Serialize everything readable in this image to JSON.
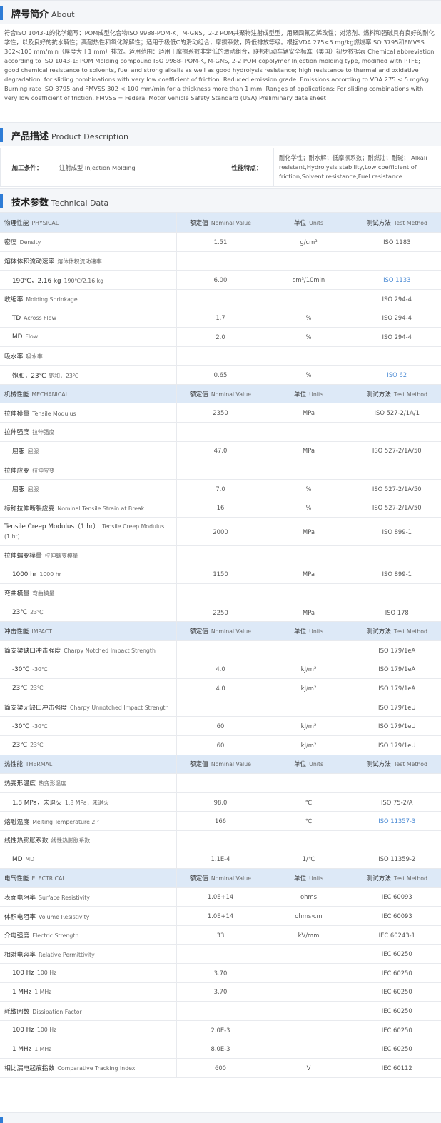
{
  "sections": {
    "about": {
      "cn": "牌号简介",
      "en": "About"
    },
    "desc": {
      "cn": "产品描述",
      "en": "Product Description"
    },
    "tech": {
      "cn": "技术参数",
      "en": "Technical Data"
    }
  },
  "about_text": "符合ISO 1043-1的化学缩写：POM成型化合物ISO 9988-POM-K，M-GNS，2-2 POM共聚物注射成型型，用聚四氟乙烯改性；对溶剂、燃料和强碱具有良好的耐化学性，以及良好的抗水解性；高耐热性和氧化降解性；适用于极低C的滑动组合，摩擦系数，降低排放等级。根据VDA 275<5 mg/kg燃烧率ISO 3795和FMVSS 302<100 mm/min（厚度大于1 mm）排放。适用范围：适用于摩擦系数非常低的滑动组合，联邦机动车辆安全标准（美国）初步数据表 Chemical abbreviation according to ISO 1043-1: POM Molding compound ISO 9988- POM-K, M-GNS, 2-2 POM copolymer Injection molding type, modified with PTFE; good chemical resistance to solvents, fuel and strong alkalis as well as good hydrolysis resistance; high resistance to thermal and oxidative degradation; for sliding combinations with very low coefficient of friction. Reduced emission grade. Emissions according to VDA 275 < 5 mg/kg Burning rate ISO 3795 and FMVSS 302 < 100 mm/min for a thickness more than 1 mm. Ranges of applications: For sliding combinations with very low coefficient of friction. FMVSS = Federal Motor Vehicle Safety Standard (USA) Preliminary data sheet",
  "description": {
    "processing_label": "加工条件：",
    "processing_value": "注射成型  Injection Molding",
    "features_label": "性能特点：",
    "features_value": "耐化学性；耐水解；低摩擦系数；耐燃油；耐碱；  Alkali resistant,Hydrolysis stability,Low coefficient of friction,Solvent resistance,Fuel resistance"
  },
  "header_labels": {
    "nominal_cn": "额定值",
    "nominal_en": "Nominal Value",
    "units_cn": "单位",
    "units_en": "Units",
    "method_cn": "测试方法",
    "method_en": "Test Method"
  },
  "rows": [
    {
      "type": "cat",
      "cn": "物理性能",
      "en": "PHYSICAL"
    },
    {
      "type": "prop",
      "cn": "密度",
      "en": "Density",
      "value": "1.51",
      "unit": "g/cm³",
      "method": "ISO 1183"
    },
    {
      "type": "prop",
      "cn": "熔体体积流动速率",
      "en": "熔体体积流动速率",
      "value": "",
      "unit": "",
      "method": ""
    },
    {
      "type": "sub",
      "cn": "190℃，2.16 kg",
      "en": "190℃/2.16 kg",
      "value": "6.00",
      "unit": "cm³/10min",
      "method": "ISO 1133",
      "link": true
    },
    {
      "type": "prop",
      "cn": "收缩率",
      "en": "Molding Shrinkage",
      "value": "",
      "unit": "",
      "method": "ISO 294-4"
    },
    {
      "type": "sub",
      "cn": "TD",
      "en": "Across Flow",
      "value": "1.7",
      "unit": "%",
      "method": "ISO 294-4"
    },
    {
      "type": "sub",
      "cn": "MD",
      "en": "Flow",
      "value": "2.0",
      "unit": "%",
      "method": "ISO 294-4"
    },
    {
      "type": "prop",
      "cn": "吸水率",
      "en": "吸水率",
      "value": "",
      "unit": "",
      "method": ""
    },
    {
      "type": "sub",
      "cn": "饱和，23℃",
      "en": "饱和，23℃",
      "value": "0.65",
      "unit": "%",
      "method": "ISO 62",
      "link": true
    },
    {
      "type": "cat",
      "cn": "机械性能",
      "en": "MECHANICAL"
    },
    {
      "type": "prop",
      "cn": "拉伸模量",
      "en": "Tensile Modulus",
      "value": "2350",
      "unit": "MPa",
      "method": "ISO 527-2/1A/1"
    },
    {
      "type": "prop",
      "cn": "拉伸强度",
      "en": "拉伸强度",
      "value": "",
      "unit": "",
      "method": ""
    },
    {
      "type": "sub",
      "cn": "屈服",
      "en": "屈服",
      "value": "47.0",
      "unit": "MPa",
      "method": "ISO 527-2/1A/50"
    },
    {
      "type": "prop",
      "cn": "拉伸应变",
      "en": "拉伸应变",
      "value": "",
      "unit": "",
      "method": ""
    },
    {
      "type": "sub",
      "cn": "屈服",
      "en": "屈服",
      "value": "7.0",
      "unit": "%",
      "method": "ISO 527-2/1A/50"
    },
    {
      "type": "prop",
      "cn": "标称拉伸断裂应变",
      "en": "Nominal Tensile Strain at Break",
      "value": "16",
      "unit": "%",
      "method": "ISO 527-2/1A/50"
    },
    {
      "type": "prop",
      "tall": true,
      "cn": "Tensile Creep Modulus（1 hr）",
      "en": "Tensile Creep Modulus (1 hr)",
      "value": "2000",
      "unit": "MPa",
      "method": "ISO 899-1"
    },
    {
      "type": "prop",
      "cn": "拉伸蠕变模量",
      "en": "拉伸蠕变模量",
      "value": "",
      "unit": "",
      "method": ""
    },
    {
      "type": "sub",
      "cn": "1000 hr",
      "en": "1000 hr",
      "value": "1150",
      "unit": "MPa",
      "method": "ISO 899-1"
    },
    {
      "type": "prop",
      "cn": "弯曲模量",
      "en": "弯曲模量",
      "value": "",
      "unit": "",
      "method": ""
    },
    {
      "type": "sub",
      "cn": "23℃",
      "en": "23℃",
      "value": "2250",
      "unit": "MPa",
      "method": "ISO 178"
    },
    {
      "type": "cat",
      "cn": "冲击性能",
      "en": "IMPACT"
    },
    {
      "type": "prop",
      "cn": "简支梁缺口冲击强度",
      "en": "Charpy Notched Impact Strength",
      "value": "",
      "unit": "",
      "method": "ISO 179/1eA"
    },
    {
      "type": "sub",
      "cn": "-30℃",
      "en": "-30℃",
      "value": "4.0",
      "unit": "kJ/m²",
      "method": "ISO 179/1eA"
    },
    {
      "type": "sub",
      "cn": "23℃",
      "en": "23℃",
      "value": "4.0",
      "unit": "kJ/m²",
      "method": "ISO 179/1eA"
    },
    {
      "type": "prop",
      "cn": "简支梁无缺口冲击强度",
      "en": "Charpy Unnotched Impact Strength",
      "value": "",
      "unit": "",
      "method": "ISO 179/1eU"
    },
    {
      "type": "sub",
      "cn": "-30℃",
      "en": "-30℃",
      "value": "60",
      "unit": "kJ/m²",
      "method": "ISO 179/1eU"
    },
    {
      "type": "sub",
      "cn": "23℃",
      "en": "23℃",
      "value": "60",
      "unit": "kJ/m²",
      "method": "ISO 179/1eU"
    },
    {
      "type": "cat",
      "cn": "热性能",
      "en": "THERMAL"
    },
    {
      "type": "prop",
      "cn": "热变形温度",
      "en": "热变形温度",
      "value": "",
      "unit": "",
      "method": ""
    },
    {
      "type": "sub",
      "cn": "1.8 MPa，未退火",
      "en": "1.8 MPa，未退火",
      "value": "98.0",
      "unit": "℃",
      "method": "ISO 75-2/A"
    },
    {
      "type": "prop",
      "cn": "熔融温度",
      "en": "Melting Temperature  2 ²",
      "value": "166",
      "unit": "℃",
      "method": "ISO 11357-3",
      "link": true
    },
    {
      "type": "prop",
      "cn": "线性热膨胀系数",
      "en": "线性热膨胀系数",
      "value": "",
      "unit": "",
      "method": ""
    },
    {
      "type": "sub",
      "cn": "MD",
      "en": "MD",
      "value": "1.1E-4",
      "unit": "1/℃",
      "method": "ISO 11359-2"
    },
    {
      "type": "cat",
      "cn": "电气性能",
      "en": "ELECTRICAL"
    },
    {
      "type": "prop",
      "cn": "表面电阻率",
      "en": "Surface Resistivity",
      "value": "1.0E+14",
      "unit": "ohms",
      "method": "IEC 60093"
    },
    {
      "type": "prop",
      "cn": "体积电阻率",
      "en": "Volume Resistivity",
      "value": "1.0E+14",
      "unit": "ohms·cm",
      "method": "IEC 60093"
    },
    {
      "type": "prop",
      "cn": "介电强度",
      "en": "Electric Strength",
      "value": "33",
      "unit": "kV/mm",
      "method": "IEC 60243-1"
    },
    {
      "type": "prop",
      "cn": "相对电容率",
      "en": "Relative Permittivity",
      "value": "",
      "unit": "",
      "method": "IEC 60250"
    },
    {
      "type": "sub",
      "cn": "100 Hz",
      "en": "100 Hz",
      "value": "3.70",
      "unit": "",
      "method": "IEC 60250"
    },
    {
      "type": "sub",
      "cn": "1 MHz",
      "en": "1 MHz",
      "value": "3.70",
      "unit": "",
      "method": "IEC 60250"
    },
    {
      "type": "prop",
      "cn": "耗散因数",
      "en": "Dissipation Factor",
      "value": "",
      "unit": "",
      "method": "IEC 60250"
    },
    {
      "type": "sub",
      "cn": "100 Hz",
      "en": "100 Hz",
      "value": "2.0E-3",
      "unit": "",
      "method": "IEC 60250"
    },
    {
      "type": "sub",
      "cn": "1 MHz",
      "en": "1 MHz",
      "value": "8.0E-3",
      "unit": "",
      "method": "IEC 60250"
    },
    {
      "type": "prop",
      "cn": "相比漏电起痕指数",
      "en": "Comparative Tracking Index",
      "value": "600",
      "unit": "V",
      "method": "IEC 60112"
    }
  ]
}
